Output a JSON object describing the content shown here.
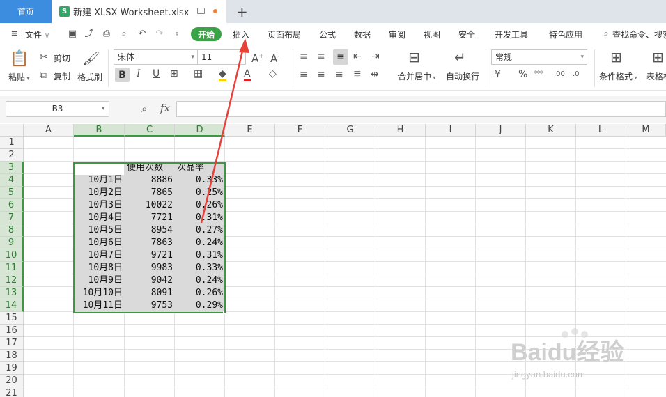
{
  "tabs": {
    "home": "首页",
    "doc_icon": "S",
    "doc_title": "新建 XLSX Worksheet.xlsx"
  },
  "menu": {
    "file": "文件",
    "start": "开始",
    "items": [
      "插入",
      "页面布局",
      "公式",
      "数据",
      "审阅",
      "视图",
      "安全",
      "开发工具",
      "特色应用"
    ],
    "search": "查找命令、搜索"
  },
  "ribbon": {
    "paste": "粘贴",
    "cut": "剪切",
    "copy": "复制",
    "format_painter": "格式刷",
    "font_name": "宋体",
    "font_size": "11",
    "merge_center": "合并居中",
    "auto_wrap": "自动换行",
    "number_format": "常规",
    "conditional_format": "条件格式",
    "table_style": "表格样"
  },
  "formula_bar": {
    "name_box": "B3",
    "fx": "fx",
    "formula": ""
  },
  "grid": {
    "columns": [
      "A",
      "B",
      "C",
      "D",
      "E",
      "F",
      "G",
      "H",
      "I",
      "J",
      "K",
      "L",
      "M"
    ],
    "active_columns": [
      "B",
      "C",
      "D"
    ],
    "rows": [
      "1",
      "2",
      "3",
      "4",
      "5",
      "6",
      "7",
      "8",
      "9",
      "10",
      "11",
      "12",
      "13",
      "14",
      "15",
      "16",
      "17",
      "18",
      "19",
      "20",
      "21"
    ],
    "active_rows": [
      "3",
      "4",
      "5",
      "6",
      "7",
      "8",
      "9",
      "10",
      "11",
      "12",
      "13",
      "14"
    ],
    "headers": {
      "C3": "使用次数",
      "D3": "次品率"
    },
    "data": [
      [
        "10月1日",
        "8886",
        "0.33%"
      ],
      [
        "10月2日",
        "7865",
        "0.25%"
      ],
      [
        "10月3日",
        "10022",
        "0.26%"
      ],
      [
        "10月4日",
        "7721",
        "0.31%"
      ],
      [
        "10月5日",
        "8954",
        "0.27%"
      ],
      [
        "10月6日",
        "7863",
        "0.24%"
      ],
      [
        "10月7日",
        "9721",
        "0.31%"
      ],
      [
        "10月8日",
        "9983",
        "0.33%"
      ],
      [
        "10月9日",
        "9042",
        "0.24%"
      ],
      [
        "10月10日",
        "8091",
        "0.26%"
      ],
      [
        "10月11日",
        "9753",
        "0.29%"
      ]
    ]
  },
  "colors": {
    "tab_active": "#3c8de0",
    "start_green": "#3aa346",
    "selection_green": "#3b9a3f",
    "arrow_red": "#e8413a"
  },
  "watermark": {
    "logo": "Baidu经验",
    "url": "jingyan.baidu.com"
  }
}
